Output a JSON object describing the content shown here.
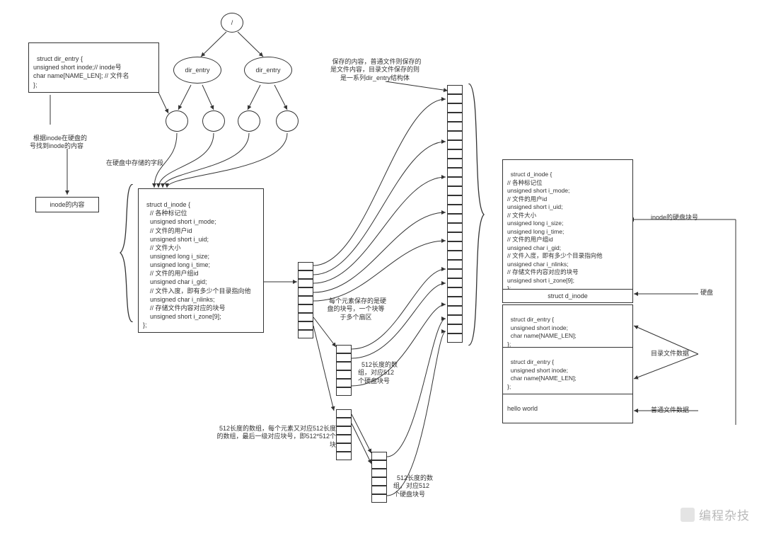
{
  "root_node": "/",
  "dir_entry_label": "dir_entry",
  "struct_dir_entry": "struct dir_entry {\nunsigned short inode;// inode号\nchar name[NAME_LEN]; // 文件名\n};",
  "text_inode_lookup": "根据inode在硬盘的\n号找到inode的内容",
  "text_inode_content": "inode的内容",
  "text_disk_fields": "在硬盘中存储的字段",
  "struct_d_inode_left": "struct d_inode {\n    // 各种标记位\n    unsigned short i_mode;\n    // 文件的用户id\n    unsigned short i_uid;\n    // 文件大小\n    unsigned long i_size;\n    unsigned long i_time;\n    // 文件的用户组id\n    unsigned char i_gid;\n    // 文件入度，即有多少个目录指向他\n    unsigned char i_nlinks;\n    // 存储文件内容对应的块号\n    unsigned short i_zone[9];\n};",
  "text_save_content": "保存的内容，普通文件则保存的\n是文件内容，目录文件保存的则\n是一系列dir_entry结构体",
  "text_block_elem": "每个元素保存的是硬\n盘的块号，一个块等\n于多个扇区",
  "text_512_right": "512长度的数\n组，对应512\n个硬盘块号",
  "text_512_left": "512长度的数组，每个元素又对应512长度\n的数组，最后一级对应块号，即512*512个\n块",
  "text_512_bottom": "512长度的数\n组，对应512\n个硬盘块号",
  "struct_d_inode_right": "struct d_inode {\n// 各种标记位\nunsigned short i_mode;\n// 文件的用户id\nunsigned short i_uid;\n// 文件大小\nunsigned long i_size;\nunsigned long i_time;\n// 文件的用户组id\nunsigned char i_gid;\n// 文件入度，即有多少个目录指向他\nunsigned char i_nlinks;\n// 存储文件内容对应的块号\nunsigned short i_zone[9];\n};",
  "right_struct_d_inode_label": "struct d_inode",
  "right_dir_entry_1": "struct dir_entry {\n  unsigned short inode;\n  char name[NAME_LEN];\n};",
  "right_dir_entry_2": "struct dir_entry {\n  unsigned short inode;\n  char name[NAME_LEN];\n};",
  "right_hello": "hello world",
  "label_inode_disk_block": "inode的硬盘块号",
  "label_disk": "硬盘",
  "label_dir_file_data": "目录文件数据",
  "label_normal_file_data": "普通文件数据",
  "watermark": "编程杂技"
}
